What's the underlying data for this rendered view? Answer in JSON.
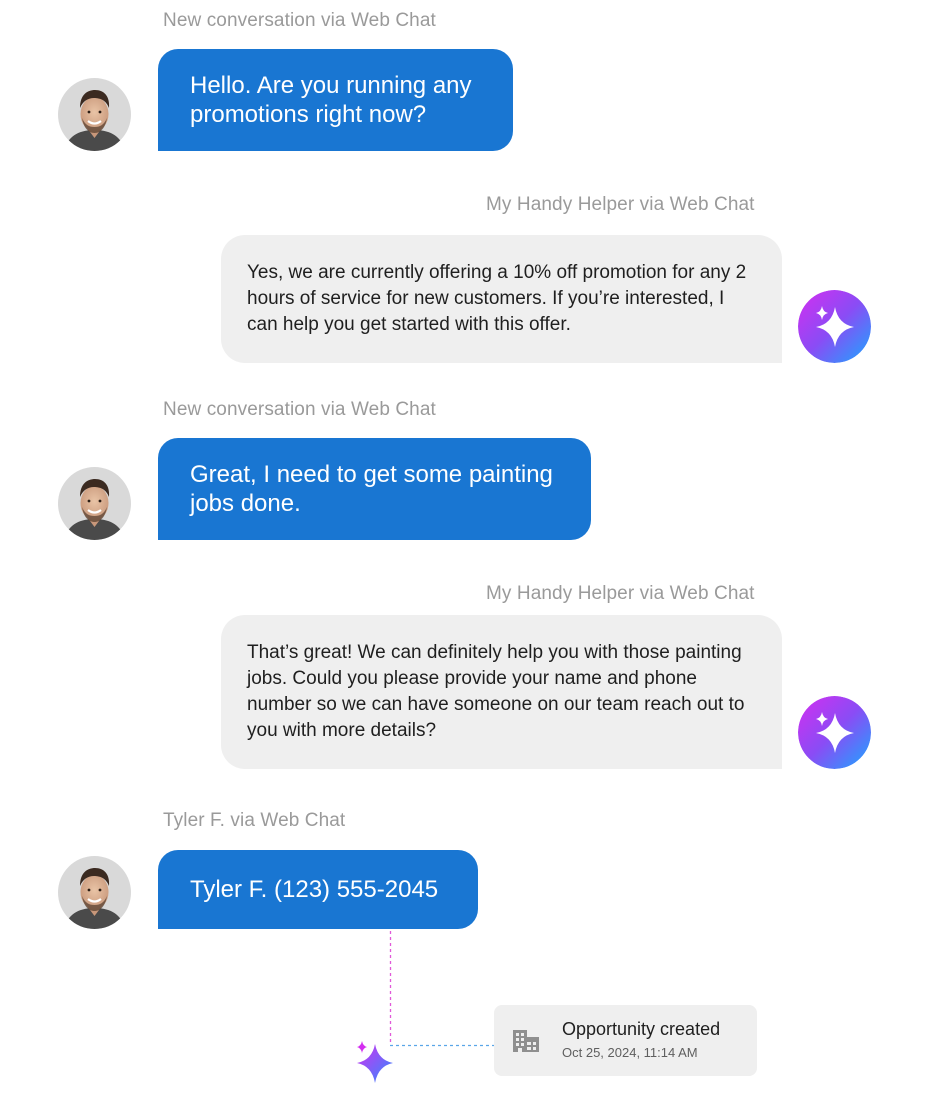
{
  "messages": [
    {
      "sender_label": "New conversation via Web Chat",
      "text": "Hello. Are you running any promotions right now?"
    },
    {
      "sender_label": "My Handy Helper via Web Chat",
      "text": "Yes, we are currently offering a 10% off promotion for any 2 hours of service for new customers. If you’re interested, I can help you get started with this offer."
    },
    {
      "sender_label": "New conversation via Web Chat",
      "text": "Great, I need to get some painting jobs done."
    },
    {
      "sender_label": "My Handy Helper via Web Chat",
      "text": "That’s great! We can definitely help you with those painting jobs. Could you please provide your name and phone number so we can have someone on our team reach out to you with more details?"
    },
    {
      "sender_label": "Tyler F. via Web Chat",
      "text": "Tyler F. (123) 555-2045"
    }
  ],
  "event": {
    "title": "Opportunity created",
    "timestamp": "Oct 25, 2024, 11:14 AM",
    "icon": "building-icon"
  },
  "colors": {
    "user_bubble": "#1976d2",
    "bot_bubble": "#efefef",
    "ai_gradient_start": "#d42ef0",
    "ai_gradient_end": "#1aa8ff",
    "connector_pink": "#e15ad8",
    "connector_blue": "#5aa6e8"
  }
}
